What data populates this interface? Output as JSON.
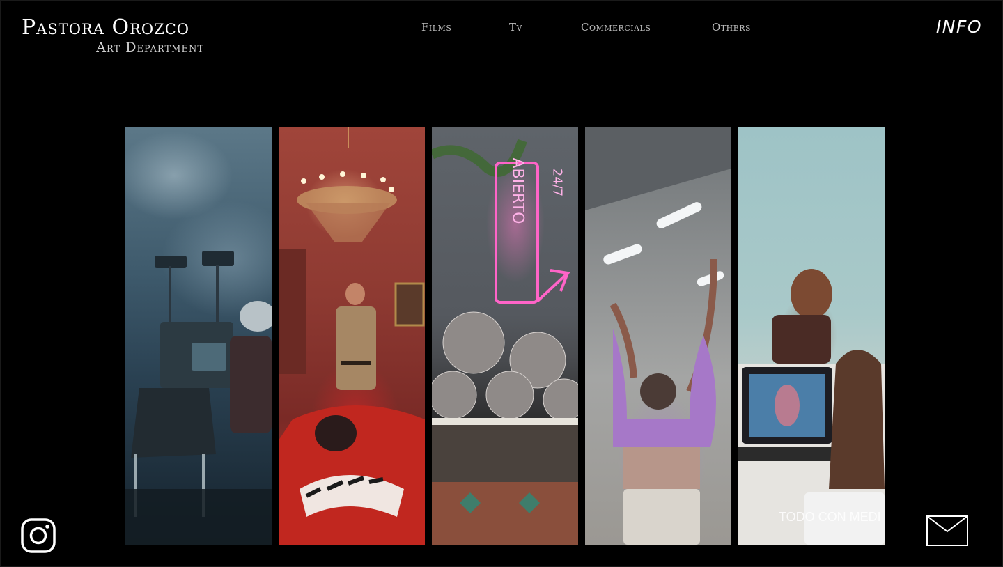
{
  "brand": {
    "name": "Pastora Orozco",
    "subtitle": "Art Department"
  },
  "nav": {
    "films": "Films",
    "tv": "Tv",
    "commercials": "Commercials",
    "others": "Others"
  },
  "info_link": "INFO",
  "panels": {
    "p3_neon_text": "ABIERTO",
    "p3_neon_hours": "24/7",
    "p5_caption": "TODO CON MEDI"
  },
  "icons": {
    "social": "instagram-icon",
    "contact": "envelope-icon"
  },
  "colors": {
    "background": "#000000",
    "text": "#ffffff",
    "nav": "#bdbdbd"
  }
}
